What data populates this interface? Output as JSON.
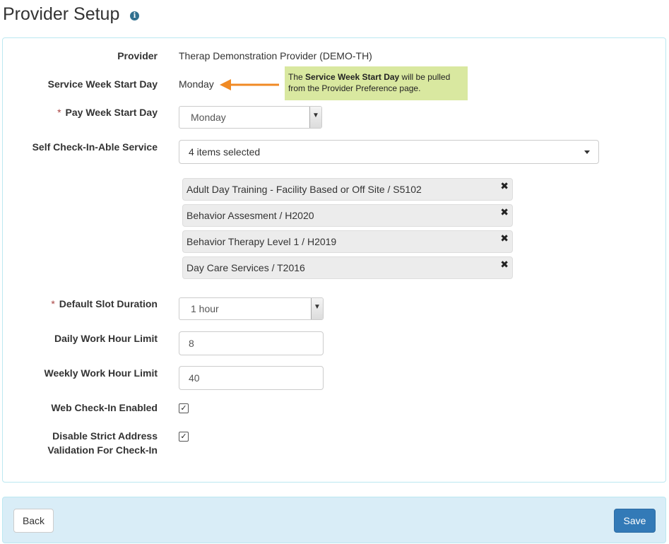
{
  "page": {
    "title": "Provider Setup",
    "info_icon": "info-circle-icon"
  },
  "form": {
    "provider": {
      "label": "Provider",
      "value": "Therap Demonstration Provider (DEMO-TH)"
    },
    "service_week": {
      "label": "Service Week Start Day",
      "value": "Monday"
    },
    "tooltip": {
      "prefix": "The ",
      "bold": "Service Week Start Day",
      "suffix": " will be pulled from the Provider Preference page."
    },
    "pay_week": {
      "required_mark": "*",
      "label": "Pay Week Start Day",
      "selected": "Monday"
    },
    "self_checkin": {
      "label": "Self Check-In-Able Service",
      "summary": "4 items selected",
      "items": [
        "Adult Day Training - Facility Based or Off Site / S5102",
        "Behavior Assesment / H2020",
        "Behavior Therapy Level 1 / H2019",
        "Day Care Services / T2016"
      ],
      "remove_glyph": "✖"
    },
    "slot_duration": {
      "required_mark": "*",
      "label": "Default Slot Duration",
      "selected": "1 hour"
    },
    "daily_limit": {
      "label": "Daily Work Hour Limit",
      "value": "8"
    },
    "weekly_limit": {
      "label": "Weekly Work Hour Limit",
      "value": "40"
    },
    "web_checkin": {
      "label": "Web Check-In Enabled",
      "checked": true
    },
    "disable_strict": {
      "label_line1": "Disable Strict Address",
      "label_line2": "Validation For Check-In",
      "checked": true
    }
  },
  "footer": {
    "back_label": "Back",
    "save_label": "Save"
  },
  "colors": {
    "primary": "#337ab7",
    "panel_border": "#bce8f1",
    "footer_bg": "#d9edf7",
    "tooltip_bg": "#d9e8a0",
    "arrow": "#f08a24",
    "required": "#a94442"
  }
}
